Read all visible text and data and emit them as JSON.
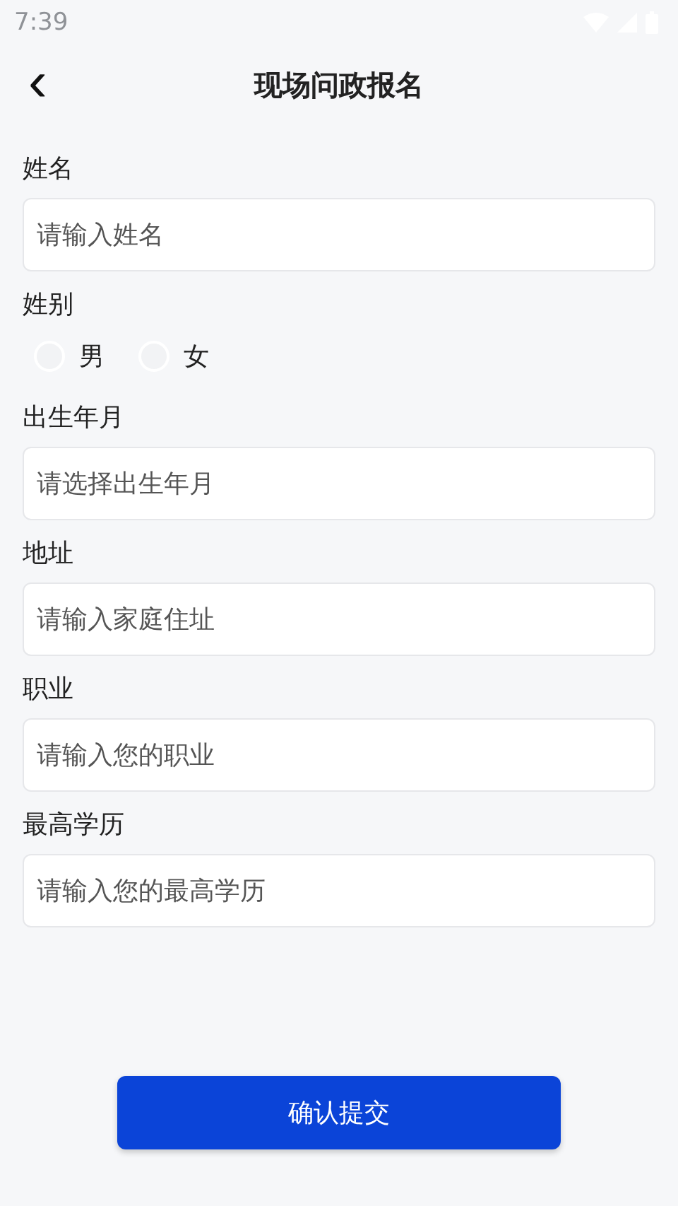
{
  "status_bar": {
    "time": "7:39"
  },
  "header": {
    "back": "‹",
    "title": "现场问政报名"
  },
  "fields": [
    {
      "kind": "input",
      "label": "姓名",
      "placeholder": "请输入姓名"
    },
    {
      "kind": "radio",
      "label": "姓别",
      "options": [
        {
          "label": "男",
          "selected": false
        },
        {
          "label": "女",
          "selected": false
        }
      ]
    },
    {
      "kind": "input",
      "label": "出生年月",
      "placeholder": "请选择出生年月"
    },
    {
      "kind": "input",
      "label": "地址",
      "placeholder": "请输入家庭住址"
    },
    {
      "kind": "input",
      "label": "职业",
      "placeholder": "请输入您的职业"
    },
    {
      "kind": "input",
      "label": "最高学历",
      "placeholder": "请输入您的最高学历"
    }
  ],
  "submit": "确认提交"
}
